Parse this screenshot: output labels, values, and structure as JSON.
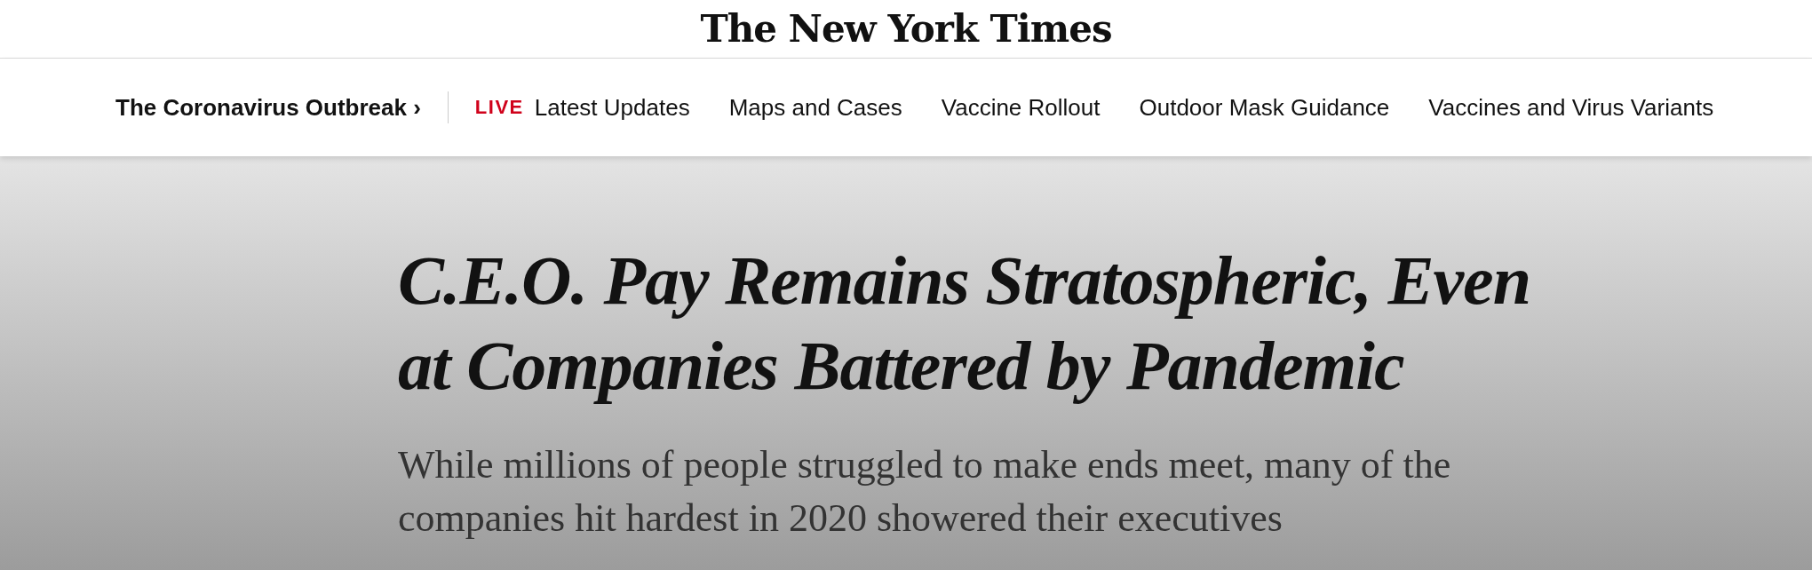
{
  "masthead": {
    "logo": "The New York Times"
  },
  "nav": {
    "section": "The Coronavirus Outbreak",
    "chevron": "›",
    "live_label": "LIVE",
    "links": [
      "Latest Updates",
      "Maps and Cases",
      "Vaccine Rollout",
      "Outdoor Mask Guidance",
      "Vaccines and Virus Variants"
    ]
  },
  "article": {
    "headline": "C.E.O. Pay Remains Stratospheric, Even at Companies Battered by Pandemic",
    "summary": "While millions of people struggled to make ends meet, many of the companies hit hardest in 2020 showered their executives"
  }
}
